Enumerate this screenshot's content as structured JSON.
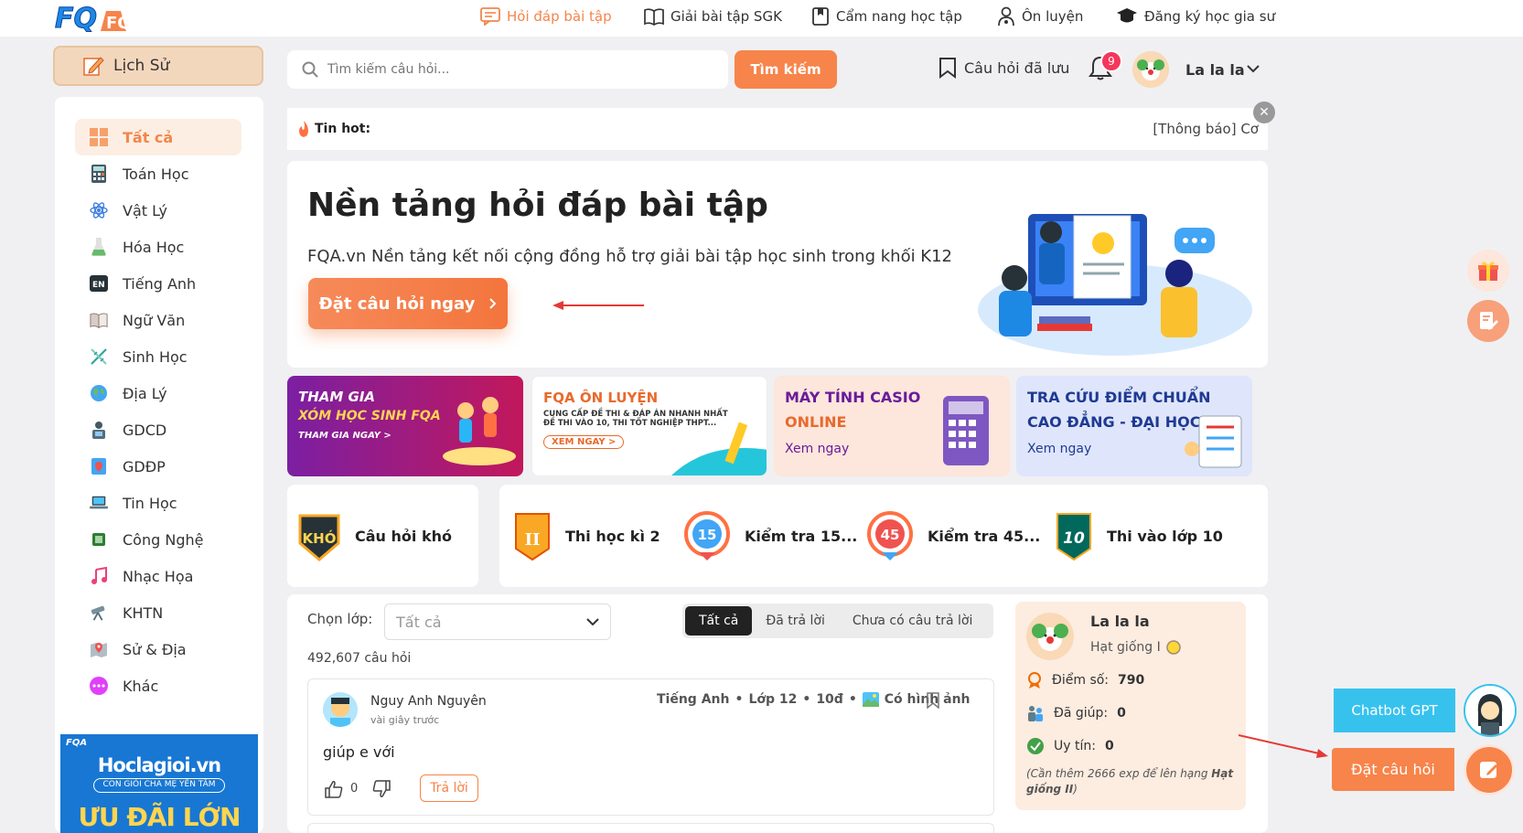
{
  "header": {
    "logo": "FQA",
    "nav": [
      {
        "label": "Hỏi đáp bài tập",
        "icon": "chat-icon",
        "active": true
      },
      {
        "label": "Giải bài tập SGK",
        "icon": "book-icon"
      },
      {
        "label": "Cẩm nang học tập",
        "icon": "bookmark-book-icon"
      },
      {
        "label": "Ôn luyện",
        "icon": "person-icon"
      },
      {
        "label": "Đăng ký học gia sư",
        "icon": "graduation-cap-icon"
      }
    ]
  },
  "sidebar": {
    "history_label": "Lịch Sử",
    "items": [
      {
        "label": "Tất cả",
        "icon": "grid-icon"
      },
      {
        "label": "Toán Học",
        "icon": "calculator-icon"
      },
      {
        "label": "Vật Lý",
        "icon": "atom-icon"
      },
      {
        "label": "Hóa Học",
        "icon": "flask-icon"
      },
      {
        "label": "Tiếng Anh",
        "icon": "en-icon"
      },
      {
        "label": "Ngữ Văn",
        "icon": "open-book-icon"
      },
      {
        "label": "Sinh Học",
        "icon": "dna-icon"
      },
      {
        "label": "Địa Lý",
        "icon": "globe-icon"
      },
      {
        "label": "GDCD",
        "icon": "citizen-icon"
      },
      {
        "label": "GDĐP",
        "icon": "map-doc-icon"
      },
      {
        "label": "Tin Học",
        "icon": "laptop-icon"
      },
      {
        "label": "Công Nghệ",
        "icon": "chip-icon"
      },
      {
        "label": "Nhạc Họa",
        "icon": "music-icon"
      },
      {
        "label": "KHTN",
        "icon": "telescope-icon"
      },
      {
        "label": "Sử & Địa",
        "icon": "map-pin-icon"
      },
      {
        "label": "Khác",
        "icon": "more-icon"
      }
    ],
    "promo": {
      "brand": "Hoclagioi.vn",
      "tagline": "CON GIỎI CHA MẸ YÊN TÂM",
      "offer": "ƯU ĐÃI LỚN"
    }
  },
  "search": {
    "placeholder": "Tìm kiếm câu hỏi...",
    "button": "Tìm kiếm"
  },
  "user_bar": {
    "saved_label": "Câu hỏi đã lưu",
    "notification_count": "9",
    "username": "La la la"
  },
  "hot": {
    "label": "Tin hot:",
    "ticker": "[Thông báo] Cơ"
  },
  "hero": {
    "title": "Nền tảng hỏi đáp bài tập",
    "subtitle": "FQA.vn Nền tảng kết nối cộng đồng hỗ trợ giải bài tập học sinh trong khối K12",
    "cta": "Đặt câu hỏi ngay"
  },
  "banners": [
    {
      "line1": "THAM GIA",
      "line2": "XÓM HỌC SINH FQA",
      "line3": "THAM GIA NGAY >"
    },
    {
      "line1": "FQA ÔN LUYỆN",
      "line2": "CUNG CẤP ĐỀ THI & ĐÁP ÁN NHANH NHẤT",
      "line3": "ĐỀ THI VÀO 10, THI TỐT NGHIỆP THPT...",
      "button": "XEM NGAY >"
    },
    {
      "line1": "MÁY TÍNH CASIO",
      "line2": "ONLINE",
      "line3": "Xem ngay"
    },
    {
      "line1": "TRA CỨU ĐIỂM CHUẨN",
      "line2": "CAO ĐẲNG - ĐẠI HỌC",
      "line3": "Xem ngay"
    }
  ],
  "exams": [
    {
      "label": "Câu hỏi khó",
      "badge_text": "KHÓ"
    },
    {
      "label": "Thi học kì 2",
      "badge_text": "II"
    },
    {
      "label": "Kiểm tra 15...",
      "badge_text": "15"
    },
    {
      "label": "Kiểm tra 45...",
      "badge_text": "45"
    },
    {
      "label": "Thi vào lớp 10",
      "badge_text": "10"
    }
  ],
  "questions": {
    "filter_label": "Chọn lớp:",
    "filter_value": "Tất cả",
    "tabs": [
      "Tất cả",
      "Đã trả lời",
      "Chưa có câu trả lời"
    ],
    "count": "492,607 câu hỏi",
    "items": [
      {
        "author": "Nguy Anh Nguyên",
        "time": "vài giây trước",
        "subject": "Tiếng Anh",
        "grade": "Lớp 12",
        "points": "10đ",
        "has_image": "Có hình ảnh",
        "content": "giúp e với",
        "likes": "0",
        "reply": "Trả lời"
      }
    ]
  },
  "user_info": {
    "name": "La la la",
    "rank": "Hạt giống I",
    "score_label": "Điểm số:",
    "score": "790",
    "helped_label": "Đã giúp:",
    "helped": "0",
    "trust_label": "Uy tín:",
    "trust": "0",
    "note_prefix": "(Cần thêm 2666 exp để lên hạng ",
    "note_rank": "Hạt giống II",
    "note_suffix": ")"
  },
  "floating": {
    "chatbot": "Chatbot GPT",
    "ask": "Đặt câu hỏi"
  },
  "colors": {
    "accent": "#f7844a",
    "chatbot": "#37c2ee",
    "badge": "#f5365c"
  }
}
